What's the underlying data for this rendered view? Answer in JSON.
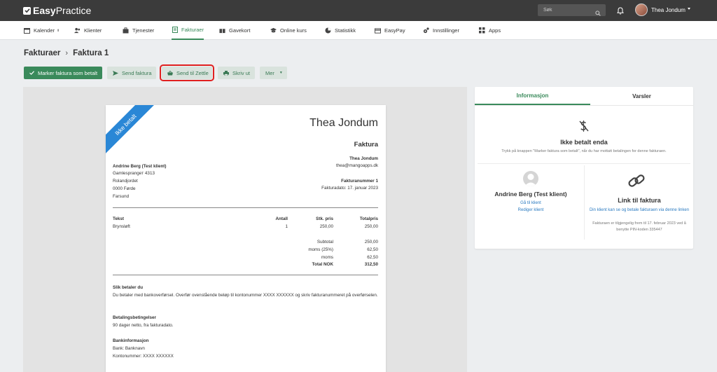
{
  "app": {
    "brand_bold": "Easy",
    "brand_light": "Practice"
  },
  "topbar": {
    "search_placeholder": "Søk",
    "user_name": "Thea Jondum"
  },
  "nav": [
    {
      "label": "Kalender",
      "icon": "calendar-icon",
      "active": false
    },
    {
      "label": "Klienter",
      "icon": "users-icon",
      "active": false
    },
    {
      "label": "Tjenester",
      "icon": "briefcase-icon",
      "active": false
    },
    {
      "label": "Fakturaer",
      "icon": "invoice-icon",
      "active": true
    },
    {
      "label": "Gavekort",
      "icon": "gift-icon",
      "active": false
    },
    {
      "label": "Online kurs",
      "icon": "course-icon",
      "active": false
    },
    {
      "label": "Statistikk",
      "icon": "stats-icon",
      "active": false
    },
    {
      "label": "EasyPay",
      "icon": "card-icon",
      "active": false
    },
    {
      "label": "Innstillinger",
      "icon": "gear-icon",
      "active": false
    },
    {
      "label": "Apps",
      "icon": "apps-icon",
      "active": false
    }
  ],
  "breadcrumb": {
    "parent": "Fakturaer",
    "current": "Faktura 1"
  },
  "toolbar": {
    "mark_paid": "Marker faktura som betalt",
    "send_invoice": "Send faktura",
    "send_zettle": "Send til Zettle",
    "print": "Skriv ut",
    "more": "Mer"
  },
  "invoice": {
    "ribbon": "Ikke betalt",
    "sender_name": "Thea Jondum",
    "doc_title": "Faktura",
    "recipient": {
      "name": "Andrine Berg (Test klient)",
      "address1": "Gamlesprangeт 4313",
      "address2": "Rolandjordet",
      "postal": "0000 Førde",
      "city": "Farsund"
    },
    "sender_block": {
      "name": "Thea Jondum",
      "email": "thea@mangoapps.dk"
    },
    "invoice_number_label": "Fakturanummer 1",
    "invoice_date": "Fakturadato: 17. januar 2023",
    "table": {
      "headers": [
        "Tekst",
        "Antall",
        "Stk. pris",
        "Totalpris"
      ],
      "rows": [
        [
          "Brynsløft",
          "1",
          "250,00",
          "250,00"
        ]
      ]
    },
    "totals": [
      {
        "label": "Subtotal",
        "value": "250,00"
      },
      {
        "label": "moms (25%)",
        "value": "62,50"
      },
      {
        "label": "moms",
        "value": "62,50"
      },
      {
        "label": "Total NOK",
        "value": "312,50"
      }
    ],
    "payment_heading": "Slik betaler du",
    "payment_text": "Du betaler med bankoverførsel. Overfør ovenstående beløp til kontonummer XXXX XXXXXX og skriv fakturanummeret på overførselen.",
    "terms_heading": "Betalingsbetingelser",
    "terms_text": "90 dager netto, fra fakturadato.",
    "bank_heading": "Bankinformasjon",
    "bank_name": "Bank: Banknavn",
    "bank_account": "Kontonummer: XXXX XXXXXX"
  },
  "panel": {
    "tabs": [
      "Informasjon",
      "Varsler"
    ],
    "status_title": "Ikke betalt enda",
    "status_sub": "Trykk på knappen \"Marker faktura som betalt\", når du har mottatt betalingen for denne fakturaen.",
    "client_name": "Andrine Berg (Test klient)",
    "go_to_client": "Gå til klient",
    "edit_client": "Rediger klient",
    "link_title": "Link til faktura",
    "link_desc": "Din klient kan se og betale fakturaen via denne linken",
    "link_note": "Fakturaen er tilgjengelig frem til 17. februar 2023 ved å benytte PIN-koden 335447"
  },
  "colors": {
    "accent": "#3a8a5b",
    "topbar": "#3b3b3b",
    "ribbon": "#2a87d6",
    "link": "#2a7ac0",
    "highlight": "#e02020"
  }
}
